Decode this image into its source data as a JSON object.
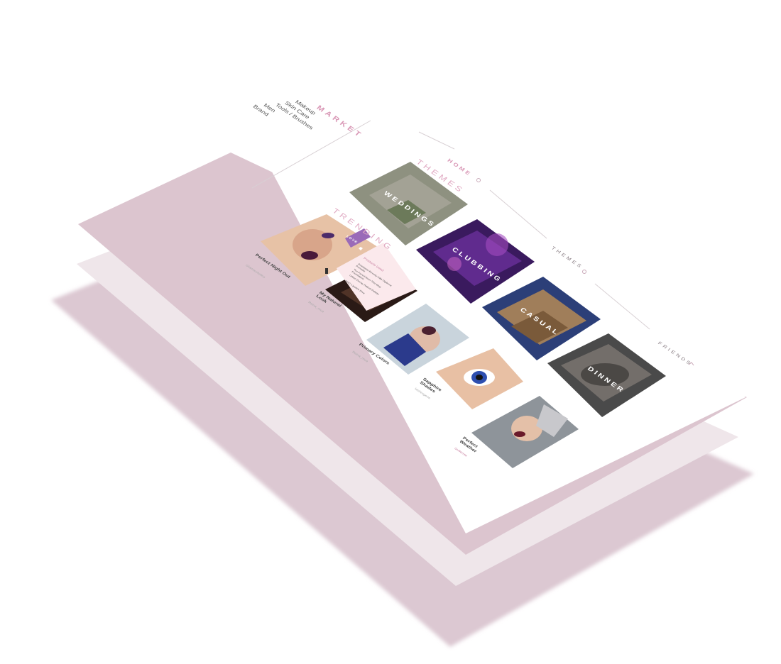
{
  "market": {
    "title": "MARKET",
    "items": [
      "Makeup",
      "Skin Care",
      "Tools / Brushes",
      "Men",
      "Brand"
    ]
  },
  "nav": {
    "home": "HOME",
    "themes": "THEMES",
    "friends": "FRIENDS"
  },
  "sections": {
    "themes_title": "THEMES",
    "trending_title": "TRENDING"
  },
  "themes": [
    {
      "label": "WEDDINGS"
    },
    {
      "label": "CLUBBING"
    },
    {
      "label": "CASUAL"
    },
    {
      "label": "DINNER"
    }
  ],
  "trending": [
    {
      "title": "Perfect Night Out",
      "sub": "Glamourholics"
    },
    {
      "title": "My Natural Look",
      "sub": "Reina_mua"
    },
    {
      "title": "Primary Colors",
      "sub": "Reina_mua"
    },
    {
      "title": "Sapphire Shades",
      "sub": "lashesgene"
    },
    {
      "title": "Perfect Weather",
      "sub": "Gutierrez"
    }
  ],
  "popup": {
    "badge": "LOVE",
    "head": "Products Used",
    "items": [
      "Anastasia Beverly Hills Dipbrow Pomade",
      "Too Faced Born This Way Foundation",
      "Urban Decay Naked Palette",
      "MAC Lipstick Diva"
    ]
  },
  "colors": {
    "accent": "#d998b6",
    "slab": "#dcc5cf",
    "slab_light": "#efe6ea",
    "badge": "#9a6ab8",
    "popup_bg": "#fbe9ec"
  },
  "icons": [
    "heart-icon",
    "comment-icon",
    "share-icon",
    "cursor-hand-icon"
  ]
}
